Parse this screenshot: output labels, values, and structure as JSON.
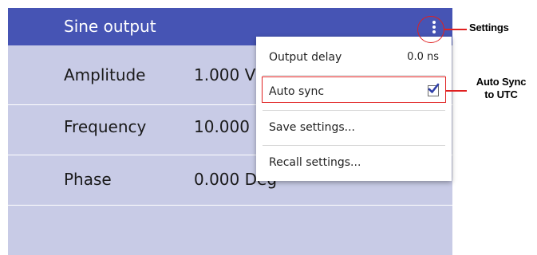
{
  "header": {
    "title": "Sine output",
    "menu_icon": "kebab-vertical-icon"
  },
  "rows": [
    {
      "label": "Amplitude",
      "value": "1.000 V"
    },
    {
      "label": "Frequency",
      "value": "10.000"
    },
    {
      "label": "Phase",
      "value": "0.000 Deg"
    }
  ],
  "menu": {
    "items": [
      {
        "label": "Output delay",
        "value": "0.0 ns"
      },
      {
        "label": "Auto sync",
        "checked": true
      },
      {
        "label": "Save settings..."
      },
      {
        "label": "Recall settings..."
      }
    ]
  },
  "annotations": {
    "settings": "Settings",
    "auto_sync_line1": "Auto Sync",
    "auto_sync_line2": "to UTC"
  },
  "colors": {
    "header": "#4654b4",
    "panel": "#c8cbe6",
    "menu_bg": "#ffffff",
    "annotation": "#e02020",
    "checkbox_mark": "#2e3ea8"
  }
}
